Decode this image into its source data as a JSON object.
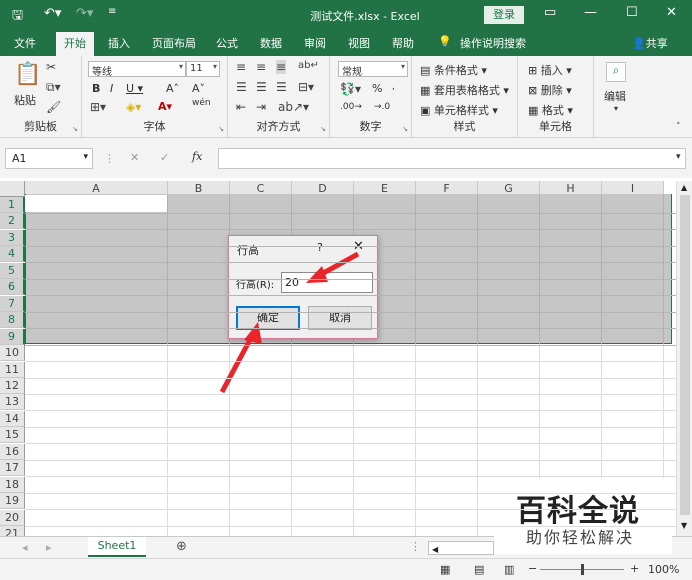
{
  "titlebar": {
    "title": "测试文件.xlsx  -  Excel",
    "login": "登录"
  },
  "tabs": [
    {
      "label": "文件"
    },
    {
      "label": "开始"
    },
    {
      "label": "插入"
    },
    {
      "label": "页面布局"
    },
    {
      "label": "公式"
    },
    {
      "label": "数据"
    },
    {
      "label": "审阅"
    },
    {
      "label": "视图"
    },
    {
      "label": "帮助"
    },
    {
      "label": "操作说明搜索"
    },
    {
      "label": "共享"
    }
  ],
  "ribbon": {
    "clipboard": {
      "label": "剪贴板",
      "paste": "粘贴"
    },
    "font": {
      "label": "字体",
      "name": "等线",
      "size": "11",
      "wen": "wén"
    },
    "align": {
      "label": "对齐方式"
    },
    "number": {
      "label": "数字",
      "format": "常规"
    },
    "styles": {
      "label": "样式",
      "cond": "条件格式",
      "table": "套用表格格式",
      "cell": "单元格样式"
    },
    "cells": {
      "label": "单元格",
      "insert": "插入",
      "delete": "删除",
      "format": "格式"
    },
    "edit": {
      "label": "编辑"
    }
  },
  "formula": {
    "namebox": "A1",
    "value": ""
  },
  "columns": [
    "A",
    "B",
    "C",
    "D",
    "E",
    "F",
    "G",
    "H",
    "I"
  ],
  "rows": [
    "1",
    "2",
    "3",
    "4",
    "5",
    "6",
    "7",
    "8",
    "9",
    "10",
    "11",
    "12",
    "13",
    "14",
    "15",
    "16",
    "17",
    "18",
    "19",
    "20",
    "21"
  ],
  "dialog": {
    "title": "行高",
    "help": "?",
    "close": "✕",
    "label": "行高(R):",
    "value": "20",
    "ok": "确定",
    "cancel": "取消"
  },
  "sheet": {
    "name": "Sheet1",
    "zoom": "100%"
  },
  "watermark": {
    "title": "百科全说",
    "subtitle": "助你轻松解决"
  }
}
